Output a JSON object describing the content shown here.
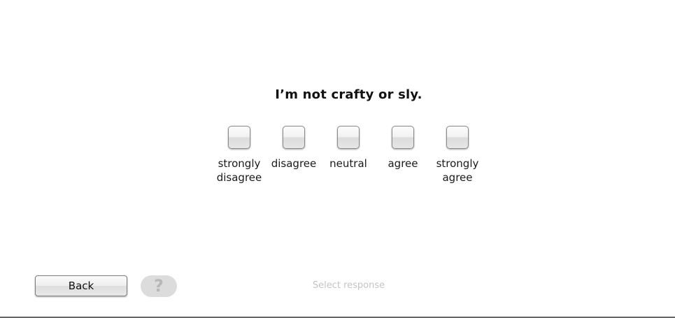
{
  "question": {
    "text": "I’m not crafty or sly."
  },
  "options": [
    {
      "label": "strongly\ndisagree"
    },
    {
      "label": "disagree"
    },
    {
      "label": "neutral"
    },
    {
      "label": "agree"
    },
    {
      "label": "strongly\nagree"
    }
  ],
  "footer": {
    "back_label": "Back",
    "help_icon": "question-mark-icon",
    "help_glyph": "?",
    "status_text": "Select response"
  }
}
